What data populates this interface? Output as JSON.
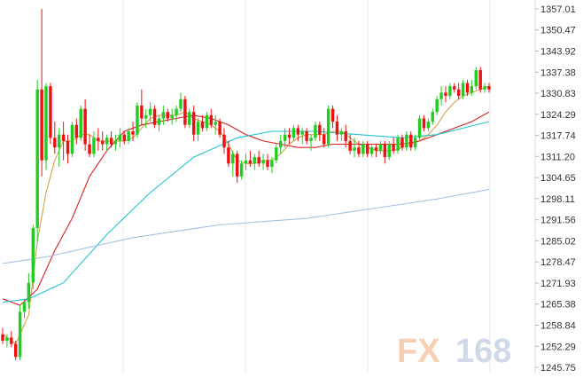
{
  "watermark": {
    "prefix": "FX",
    "number": "168",
    "prefix_color": "#f6c7a8",
    "number_color": "#c8d3e6"
  },
  "chart_data": {
    "type": "candlestick",
    "title": "",
    "xlabel": "",
    "ylabel": "",
    "ylim": [
      1245.75,
      1357.01
    ],
    "y_ticks": [
      "1357.01",
      "1350.47",
      "1343.92",
      "1337.38",
      "1330.83",
      "1324.29",
      "1317.74",
      "1311.20",
      "1304.65",
      "1298.11",
      "1291.56",
      "1285.02",
      "1278.47",
      "1271.93",
      "1265.38",
      "1258.84",
      "1252.29",
      "1245.75"
    ],
    "grid": "vertical",
    "colors": {
      "up": "#22cc22",
      "down": "#ee1111",
      "ma_short": "#d4a24c",
      "ma_mid": "#dd2222",
      "ma_long": "#22c4cc",
      "ma_longest": "#a6c2e2"
    },
    "candles": [
      [
        1256,
        1258,
        1253,
        1254
      ],
      [
        1254,
        1256,
        1252,
        1255
      ],
      [
        1255,
        1257,
        1252,
        1253
      ],
      [
        1253,
        1254,
        1248,
        1249
      ],
      [
        1249,
        1265,
        1248,
        1263
      ],
      [
        1263,
        1267,
        1261,
        1266
      ],
      [
        1266,
        1275,
        1264,
        1272
      ],
      [
        1272,
        1290,
        1270,
        1289
      ],
      [
        1289,
        1335,
        1285,
        1332
      ],
      [
        1332,
        1357,
        1305,
        1310
      ],
      [
        1310,
        1334,
        1307,
        1333
      ],
      [
        1333,
        1334,
        1315,
        1317
      ],
      [
        1317,
        1322,
        1312,
        1314
      ],
      [
        1314,
        1320,
        1308,
        1318
      ],
      [
        1318,
        1322,
        1310,
        1316
      ],
      [
        1316,
        1318,
        1309,
        1312
      ],
      [
        1312,
        1322,
        1311,
        1321
      ],
      [
        1321,
        1323,
        1315,
        1317
      ],
      [
        1317,
        1327,
        1316,
        1326
      ],
      [
        1326,
        1329,
        1313,
        1315
      ],
      [
        1315,
        1318,
        1311,
        1312
      ],
      [
        1312,
        1319,
        1311,
        1317
      ],
      [
        1317,
        1320,
        1313,
        1316
      ],
      [
        1316,
        1319,
        1313,
        1315
      ],
      [
        1315,
        1318,
        1313,
        1317
      ],
      [
        1317,
        1319,
        1314,
        1315
      ],
      [
        1315,
        1318,
        1313,
        1316
      ],
      [
        1316,
        1320,
        1314,
        1318
      ],
      [
        1318,
        1319,
        1315,
        1316
      ],
      [
        1316,
        1320,
        1315,
        1319
      ],
      [
        1319,
        1322,
        1316,
        1318
      ],
      [
        1318,
        1328,
        1317,
        1327
      ],
      [
        1327,
        1332,
        1321,
        1323
      ],
      [
        1323,
        1326,
        1320,
        1324
      ],
      [
        1324,
        1328,
        1322,
        1326
      ],
      [
        1326,
        1327,
        1320,
        1321
      ],
      [
        1321,
        1324,
        1319,
        1323
      ],
      [
        1323,
        1327,
        1321,
        1325
      ],
      [
        1325,
        1326,
        1322,
        1323
      ],
      [
        1323,
        1326,
        1321,
        1324
      ],
      [
        1324,
        1327,
        1322,
        1326
      ],
      [
        1326,
        1331,
        1325,
        1329
      ],
      [
        1329,
        1330,
        1320,
        1321
      ],
      [
        1321,
        1326,
        1320,
        1325
      ],
      [
        1325,
        1327,
        1316,
        1318
      ],
      [
        1318,
        1323,
        1316,
        1322
      ],
      [
        1322,
        1324,
        1319,
        1320
      ],
      [
        1320,
        1325,
        1319,
        1324
      ],
      [
        1324,
        1326,
        1320,
        1321
      ],
      [
        1321,
        1324,
        1318,
        1322
      ],
      [
        1322,
        1323,
        1317,
        1318
      ],
      [
        1318,
        1320,
        1312,
        1314
      ],
      [
        1314,
        1316,
        1308,
        1309
      ],
      [
        1309,
        1313,
        1305,
        1312
      ],
      [
        1312,
        1313,
        1303,
        1305
      ],
      [
        1305,
        1310,
        1304,
        1309
      ],
      [
        1309,
        1312,
        1307,
        1310
      ],
      [
        1310,
        1313,
        1308,
        1309
      ],
      [
        1309,
        1312,
        1307,
        1311
      ],
      [
        1311,
        1313,
        1308,
        1309
      ],
      [
        1309,
        1312,
        1307,
        1310
      ],
      [
        1310,
        1312,
        1307,
        1308
      ],
      [
        1308,
        1311,
        1306,
        1310
      ],
      [
        1310,
        1315,
        1309,
        1314
      ],
      [
        1314,
        1318,
        1312,
        1316
      ],
      [
        1316,
        1320,
        1314,
        1318
      ],
      [
        1318,
        1320,
        1315,
        1317
      ],
      [
        1317,
        1321,
        1316,
        1320
      ],
      [
        1320,
        1321,
        1316,
        1318
      ],
      [
        1318,
        1320,
        1315,
        1319
      ],
      [
        1319,
        1320,
        1315,
        1316
      ],
      [
        1316,
        1318,
        1313,
        1317
      ],
      [
        1317,
        1322,
        1316,
        1321
      ],
      [
        1321,
        1322,
        1316,
        1318
      ],
      [
        1318,
        1320,
        1314,
        1315
      ],
      [
        1315,
        1327,
        1314,
        1326
      ],
      [
        1326,
        1327,
        1320,
        1322
      ],
      [
        1322,
        1324,
        1316,
        1318
      ],
      [
        1318,
        1320,
        1316,
        1319
      ],
      [
        1319,
        1321,
        1314,
        1316
      ],
      [
        1316,
        1318,
        1312,
        1313
      ],
      [
        1313,
        1317,
        1311,
        1314
      ],
      [
        1314,
        1316,
        1311,
        1312
      ],
      [
        1312,
        1316,
        1311,
        1315
      ],
      [
        1315,
        1316,
        1311,
        1312
      ],
      [
        1312,
        1315,
        1311,
        1314
      ],
      [
        1314,
        1315,
        1311,
        1313
      ],
      [
        1313,
        1316,
        1312,
        1315
      ],
      [
        1315,
        1316,
        1309,
        1311
      ],
      [
        1311,
        1316,
        1310,
        1315
      ],
      [
        1315,
        1317,
        1312,
        1313
      ],
      [
        1313,
        1318,
        1312,
        1317
      ],
      [
        1317,
        1318,
        1313,
        1314
      ],
      [
        1314,
        1319,
        1313,
        1318
      ],
      [
        1318,
        1319,
        1313,
        1314
      ],
      [
        1314,
        1318,
        1313,
        1317
      ],
      [
        1317,
        1324,
        1316,
        1323
      ],
      [
        1323,
        1324,
        1319,
        1320
      ],
      [
        1320,
        1323,
        1319,
        1322
      ],
      [
        1322,
        1326,
        1321,
        1325
      ],
      [
        1325,
        1330,
        1324,
        1329
      ],
      [
        1329,
        1333,
        1327,
        1331
      ],
      [
        1331,
        1333,
        1328,
        1330
      ],
      [
        1330,
        1334,
        1329,
        1333
      ],
      [
        1333,
        1334,
        1331,
        1332
      ],
      [
        1332,
        1334,
        1329,
        1330
      ],
      [
        1330,
        1335,
        1329,
        1334
      ],
      [
        1334,
        1335,
        1330,
        1331
      ],
      [
        1331,
        1335,
        1330,
        1333
      ],
      [
        1333,
        1339,
        1332,
        1338
      ],
      [
        1338,
        1339,
        1331,
        1332
      ],
      [
        1332,
        1334,
        1331,
        1333
      ],
      [
        1333,
        1334,
        1331,
        1332
      ]
    ],
    "series": [
      {
        "type": "line",
        "color": "#d4a24c",
        "values": [
          [
            0,
            1256
          ],
          [
            3,
            1253
          ],
          [
            6,
            1262
          ],
          [
            8,
            1285
          ],
          [
            10,
            1300
          ],
          [
            12,
            1310
          ],
          [
            14,
            1316
          ],
          [
            16,
            1316
          ],
          [
            18,
            1318
          ],
          [
            20,
            1318
          ],
          [
            22,
            1316
          ],
          [
            24,
            1316
          ],
          [
            26,
            1316
          ],
          [
            28,
            1316
          ],
          [
            30,
            1317
          ],
          [
            32,
            1320
          ],
          [
            34,
            1323
          ],
          [
            36,
            1324
          ],
          [
            38,
            1324
          ],
          [
            40,
            1324
          ],
          [
            42,
            1325
          ],
          [
            44,
            1323
          ],
          [
            46,
            1322
          ],
          [
            48,
            1321
          ],
          [
            50,
            1319
          ],
          [
            52,
            1315
          ],
          [
            54,
            1310
          ],
          [
            56,
            1309
          ],
          [
            58,
            1309
          ],
          [
            60,
            1310
          ],
          [
            62,
            1310
          ],
          [
            64,
            1312
          ],
          [
            66,
            1315
          ],
          [
            68,
            1317
          ],
          [
            70,
            1318
          ],
          [
            72,
            1318
          ],
          [
            74,
            1318
          ],
          [
            76,
            1319
          ],
          [
            78,
            1319
          ],
          [
            80,
            1317
          ],
          [
            82,
            1315
          ],
          [
            84,
            1314
          ],
          [
            86,
            1313
          ],
          [
            88,
            1313
          ],
          [
            90,
            1313
          ],
          [
            92,
            1314
          ],
          [
            94,
            1315
          ],
          [
            96,
            1316
          ],
          [
            98,
            1318
          ],
          [
            100,
            1321
          ],
          [
            102,
            1325
          ],
          [
            104,
            1328
          ],
          [
            106,
            1330
          ],
          [
            108,
            1331
          ],
          [
            110,
            1332
          ],
          [
            112,
            1333
          ]
        ]
      },
      {
        "type": "line",
        "color": "#dd2222",
        "values": [
          [
            0,
            1267
          ],
          [
            4,
            1265
          ],
          [
            8,
            1270
          ],
          [
            12,
            1282
          ],
          [
            16,
            1292
          ],
          [
            20,
            1305
          ],
          [
            24,
            1313
          ],
          [
            28,
            1319
          ],
          [
            32,
            1321
          ],
          [
            36,
            1322
          ],
          [
            40,
            1323
          ],
          [
            44,
            1324
          ],
          [
            48,
            1323
          ],
          [
            52,
            1321
          ],
          [
            56,
            1318
          ],
          [
            60,
            1316
          ],
          [
            64,
            1315
          ],
          [
            68,
            1314
          ],
          [
            72,
            1314
          ],
          [
            76,
            1315
          ],
          [
            80,
            1315
          ],
          [
            84,
            1315
          ],
          [
            88,
            1315
          ],
          [
            92,
            1315
          ],
          [
            96,
            1316
          ],
          [
            100,
            1318
          ],
          [
            104,
            1320
          ],
          [
            108,
            1322
          ],
          [
            112,
            1325
          ]
        ]
      },
      {
        "type": "line",
        "color": "#22c4cc",
        "values": [
          [
            0,
            1266
          ],
          [
            6,
            1267
          ],
          [
            14,
            1272
          ],
          [
            24,
            1287
          ],
          [
            34,
            1300
          ],
          [
            44,
            1311
          ],
          [
            54,
            1317
          ],
          [
            62,
            1319
          ],
          [
            72,
            1319
          ],
          [
            82,
            1318
          ],
          [
            92,
            1317
          ],
          [
            100,
            1318
          ],
          [
            106,
            1320
          ],
          [
            112,
            1322
          ]
        ]
      },
      {
        "type": "line",
        "color": "#a6c2e2",
        "values": [
          [
            0,
            1278
          ],
          [
            10,
            1280
          ],
          [
            20,
            1283
          ],
          [
            30,
            1286
          ],
          [
            40,
            1288
          ],
          [
            50,
            1290
          ],
          [
            60,
            1291
          ],
          [
            70,
            1292
          ],
          [
            80,
            1294
          ],
          [
            90,
            1296
          ],
          [
            100,
            1298
          ],
          [
            112,
            1301
          ]
        ]
      }
    ]
  }
}
